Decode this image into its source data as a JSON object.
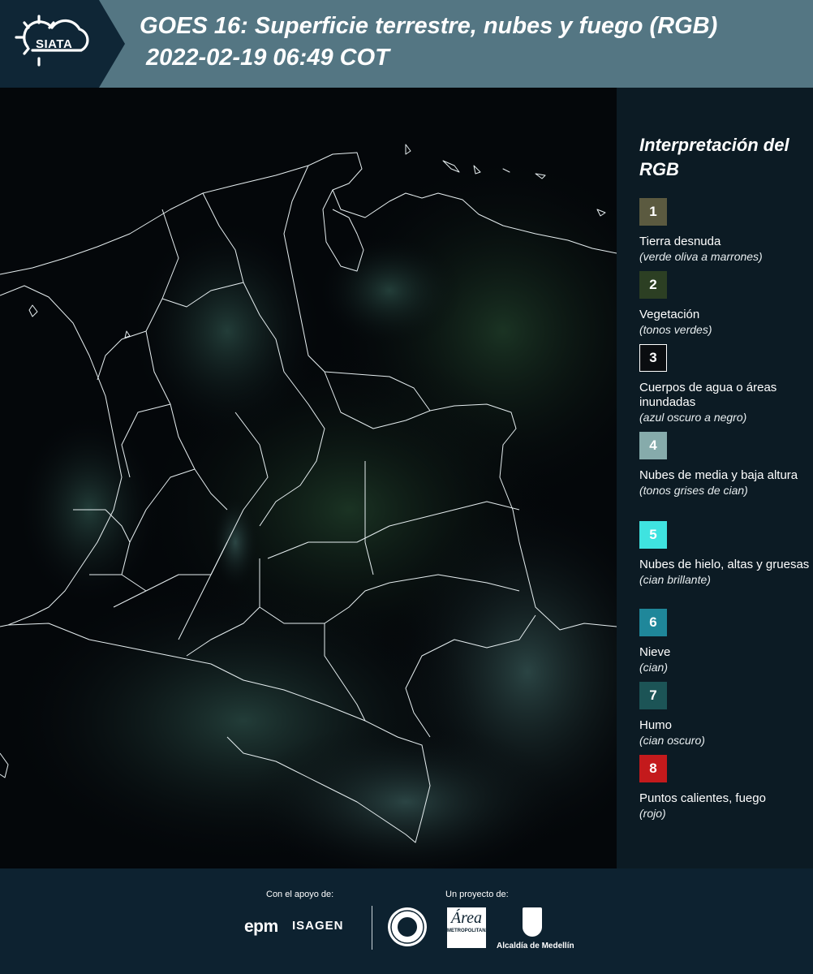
{
  "header": {
    "logo_text": "SIATA",
    "title_line1": "GOES 16: Superficie terrestre, nubes y fuego (RGB)",
    "title_line2": "2022-02-19 06:49 COT"
  },
  "map": {
    "icon": "satellite-map",
    "background_color": "#04070a",
    "border_color": "#e6eef0"
  },
  "legend": {
    "title": "Interpretación del RGB",
    "items": [
      {
        "number": "1",
        "color": "#5b5a40",
        "label": "Tierra desnuda",
        "sub": "(verde oliva a marrones)"
      },
      {
        "number": "2",
        "color": "#2c3f23",
        "label": "Vegetación",
        "sub": "(tonos verdes)"
      },
      {
        "number": "3",
        "color": "#0a0d10",
        "label": "Cuerpos de agua o áreas inundadas",
        "sub": "(azul oscuro a negro)"
      },
      {
        "number": "4",
        "color": "#86abab",
        "label": "Nubes de media y baja altura",
        "sub": "(tonos grises de cian)"
      },
      {
        "number": "5",
        "color": "#3fe3e0",
        "label": "Nubes de hielo, altas y gruesas",
        "sub": "(cian brillante)"
      },
      {
        "number": "6",
        "color": "#1f879a",
        "label": "Nieve",
        "sub": "(cian)"
      },
      {
        "number": "7",
        "color": "#1c5456",
        "label": "Humo",
        "sub": "(cian oscuro)"
      },
      {
        "number": "8",
        "color": "#c41a1c",
        "label": "Puntos calientes, fuego",
        "sub": "(rojo)"
      }
    ]
  },
  "footer": {
    "support_label": "Con el apoyo de:",
    "project_label": "Un proyecto de:",
    "sponsor1": "epm",
    "sponsor2": "ISAGEN",
    "partner_area_big": "Área",
    "partner_area_small": "METROPOLITANA",
    "partner_city": "Alcaldía de Medellín"
  }
}
